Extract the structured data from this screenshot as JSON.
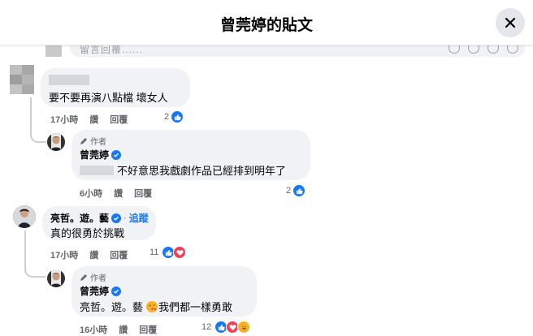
{
  "header": {
    "title": "曾莞婷的貼文"
  },
  "partial_comment": {
    "text": "留言回覆......"
  },
  "comment1": {
    "text": "要不要再演八點檔 壞女人",
    "time": "17小時",
    "like_label": "讚",
    "reply_label": "回覆",
    "reaction_count": "2"
  },
  "reply1": {
    "author_tag": "作者",
    "name": "曾莞婷",
    "text": "不好意思我戲劇作品已經排到明年了",
    "time": "6小時",
    "like_label": "讚",
    "reply_label": "回覆",
    "reaction_count": "2"
  },
  "comment2": {
    "name": "亮哲。遊。藝",
    "follow_label": "追蹤",
    "text": "真的很勇於挑戰",
    "time": "17小時",
    "like_label": "讚",
    "reply_label": "回覆",
    "reaction_count": "11"
  },
  "reply2": {
    "author_tag": "作者",
    "name": "曾莞婷",
    "text_mention": "亮哲。遊。藝",
    "text_rest": "我們都一樣勇敢",
    "time": "16小時",
    "like_label": "讚",
    "reply_label": "回覆",
    "reaction_count": "12"
  },
  "colors": {
    "accent": "#1877f2",
    "bubble": "#f0f2f5",
    "secondary_text": "#65676b"
  }
}
